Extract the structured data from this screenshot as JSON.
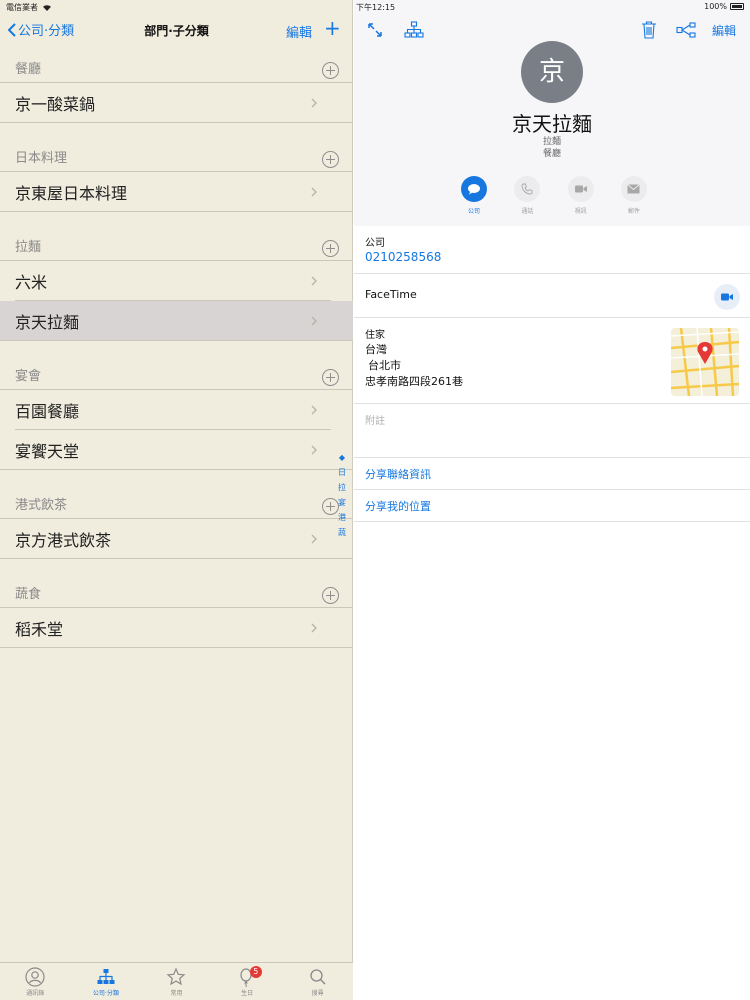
{
  "left_status": {
    "carrier": "電信業者"
  },
  "left_nav": {
    "back_label": "公司·分類",
    "title": "部門·子分類",
    "edit_label": "編輯",
    "add_label": "+"
  },
  "sections": [
    {
      "title": "餐廳",
      "items": [
        "京一酸菜鍋"
      ]
    },
    {
      "title": "日本料理",
      "items": [
        "京東屋日本料理"
      ]
    },
    {
      "title": "拉麵",
      "items": [
        "六米",
        "京天拉麵"
      ]
    },
    {
      "title": "宴會",
      "items": [
        "百園餐廳",
        "宴饗天堂"
      ]
    },
    {
      "title": "港式飲茶",
      "items": [
        "京方港式飲茶"
      ]
    },
    {
      "title": "蔬食",
      "items": [
        "稻禾堂"
      ]
    }
  ],
  "selected_item": "京天拉麵",
  "index_bar": [
    "◆",
    "日",
    "拉",
    "宴",
    "港",
    "蔬"
  ],
  "tabbar": {
    "tabs": [
      {
        "label": "通訊錄",
        "icon": "person-icon"
      },
      {
        "label": "公司·分類",
        "icon": "org-chart-icon"
      },
      {
        "label": "常用",
        "icon": "star-icon"
      },
      {
        "label": "生日",
        "icon": "balloon-icon",
        "badge": "5"
      },
      {
        "label": "搜尋",
        "icon": "search-icon"
      }
    ],
    "active_index": 1
  },
  "right_status": {
    "time": "下午12:15",
    "battery": "100%"
  },
  "right_nav": {
    "edit_label": "編輯"
  },
  "contact": {
    "avatar_initial": "京",
    "name": "京天拉麵",
    "subtitle1": "拉麵",
    "subtitle2": "餐廳",
    "actions": [
      {
        "label": "公司",
        "icon": "message-icon"
      },
      {
        "label": "通話",
        "icon": "phone-icon"
      },
      {
        "label": "視訊",
        "icon": "video-icon"
      },
      {
        "label": "郵件",
        "icon": "mail-icon"
      }
    ],
    "phone_label": "公司",
    "phone_value": "0210258568",
    "facetime_label": "FaceTime",
    "address_label": "住家",
    "address_lines": [
      "台灣",
      "台北市",
      "忠孝南路四段261巷"
    ],
    "notes_label": "附註",
    "share_contact_label": "分享聯絡資訊",
    "share_location_label": "分享我的位置"
  },
  "colors": {
    "accent": "#1677e0",
    "left_bg": "#f0ecde",
    "selected_row": "#d7d4d3",
    "avatar": "#7a7e87",
    "badge": "#e53935"
  }
}
